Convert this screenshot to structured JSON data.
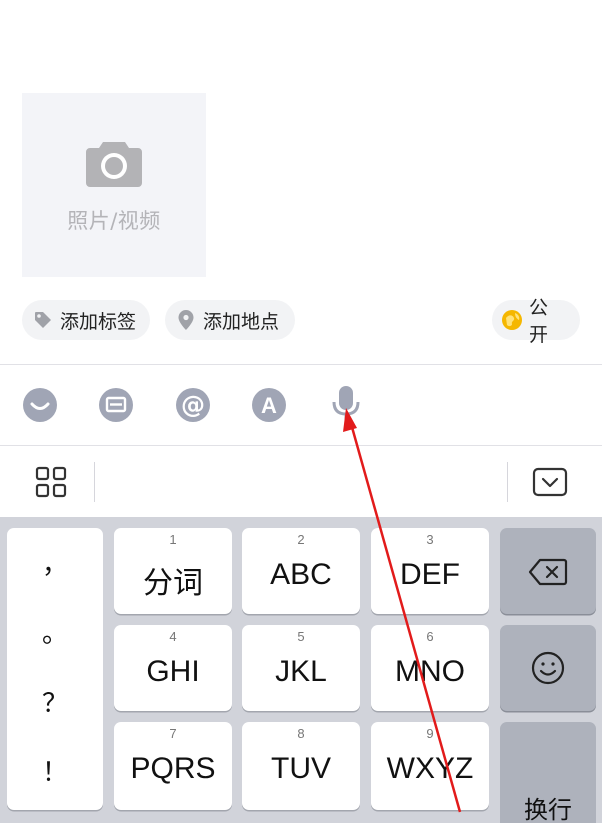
{
  "media": {
    "label": "照片/视频",
    "icon": "camera-icon"
  },
  "chips": {
    "tag": {
      "label": "添加标签",
      "icon": "tag-icon"
    },
    "location": {
      "label": "添加地点",
      "icon": "location-pin-icon"
    },
    "visibility": {
      "label": "公开",
      "icon": "globe-icon"
    }
  },
  "toolbar": {
    "icons": [
      "emoji-icon",
      "image-icon",
      "mention-icon",
      "font-icon",
      "microphone-icon"
    ]
  },
  "keyboard": {
    "top_left_icon": "grid-icon",
    "top_right_icon": "keyboard-collapse-icon",
    "punctuation": [
      "，",
      "。",
      "？",
      "！"
    ],
    "keys": [
      {
        "num": "1",
        "label": "分词"
      },
      {
        "num": "2",
        "label": "ABC"
      },
      {
        "num": "3",
        "label": "DEF"
      },
      {
        "num": "4",
        "label": "GHI"
      },
      {
        "num": "5",
        "label": "JKL"
      },
      {
        "num": "6",
        "label": "MNO"
      },
      {
        "num": "7",
        "label": "PQRS"
      },
      {
        "num": "8",
        "label": "TUV"
      },
      {
        "num": "9",
        "label": "WXYZ"
      }
    ],
    "delete_icon": "backspace-icon",
    "emoji_icon": "emoji-face-icon",
    "enter_label": "换行"
  },
  "colors": {
    "accent_yellow": "#f5b700",
    "icon_gray": "#a0a5b5",
    "annotation_red": "#e21b1b"
  }
}
